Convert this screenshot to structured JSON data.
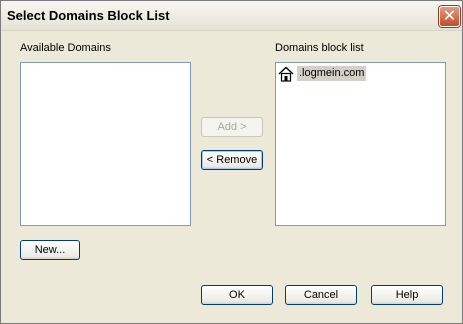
{
  "window": {
    "title": "Select Domains Block List",
    "close_glyph": "✕"
  },
  "available": {
    "label": "Available Domains",
    "items": []
  },
  "blocked": {
    "label": "Domains block list",
    "items": [
      {
        "icon": "house-icon",
        "text": ".logmein.com"
      }
    ]
  },
  "buttons": {
    "add": "Add  >",
    "remove": "<  Remove",
    "new": "New...",
    "ok": "OK",
    "cancel": "Cancel",
    "help": "Help"
  }
}
